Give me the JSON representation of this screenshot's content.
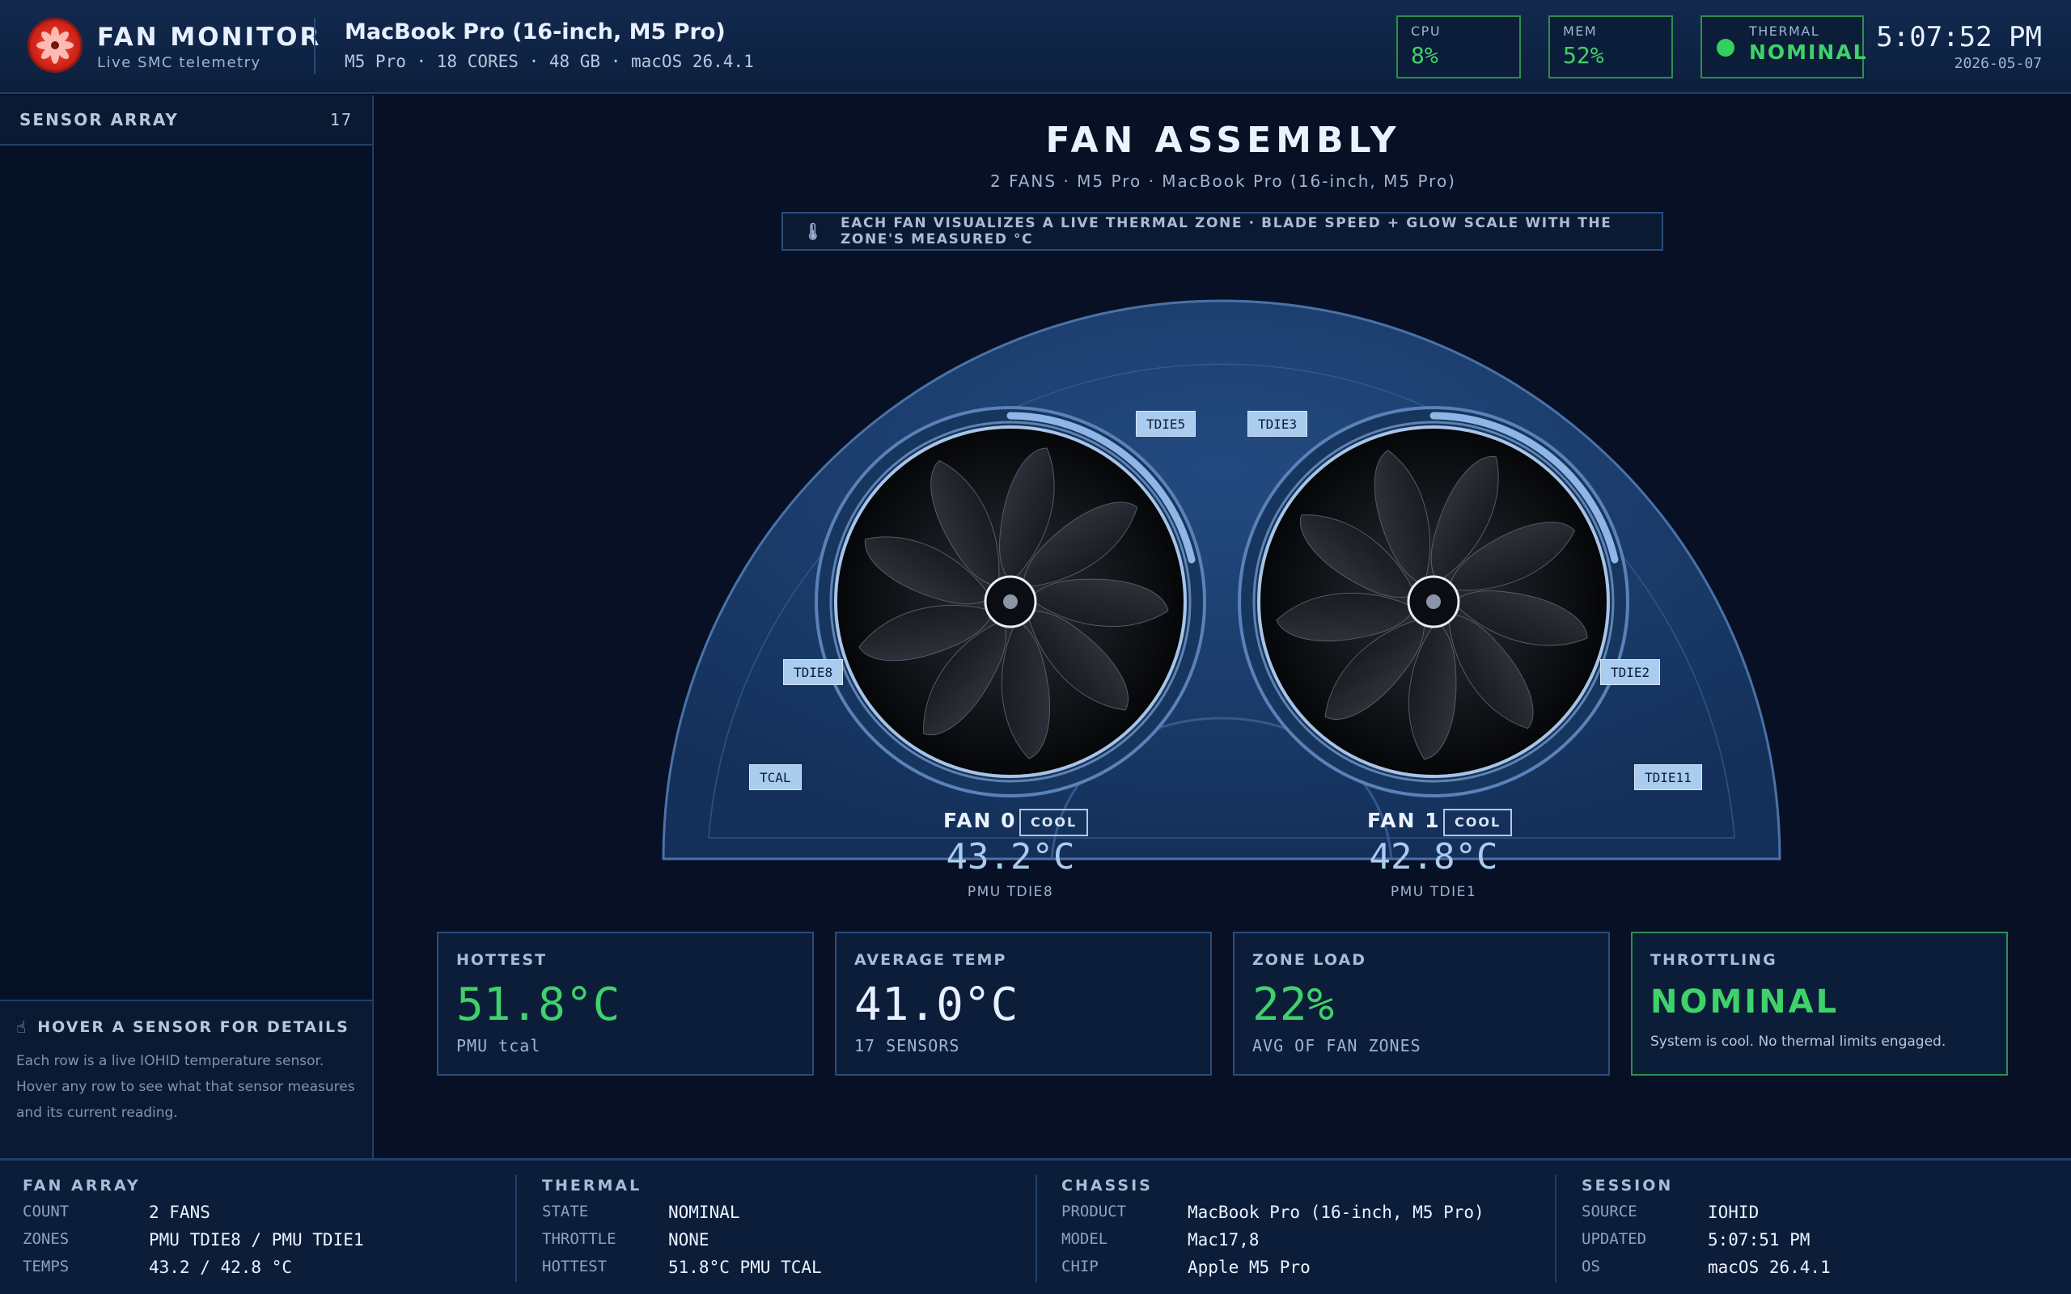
{
  "header": {
    "app_title": "FAN MONITOR",
    "app_subtitle": "Live SMC telemetry",
    "device_title": "MacBook Pro (16-inch, M5 Pro)",
    "device_specs": "M5 Pro · 18 CORES · 48 GB · macOS 26.4.1",
    "cpu_label": "CPU",
    "cpu_value": "8%",
    "mem_label": "MEM",
    "mem_value": "52%",
    "thermal_label": "THERMAL",
    "thermal_value": "NOMINAL",
    "clock": "5:07:52 PM",
    "date": "2026-05-07",
    "accent_green": "#3fd16a"
  },
  "sidebar": {
    "title": "SENSOR ARRAY",
    "count": "17",
    "help_title": "HOVER A SENSOR FOR DETAILS",
    "help_text": "Each row is a live IOHID temperature sensor. Hover any row to see what that sensor measures and its current reading.",
    "help_icon": "pointer-hand-icon"
  },
  "main": {
    "title": "FAN ASSEMBLY",
    "subtitle": "2 FANS · M5 Pro · MacBook Pro (16-inch, M5 Pro)",
    "banner_icon": "thermometer-icon",
    "banner": "EACH FAN VISUALIZES A LIVE THERMAL ZONE · BLADE SPEED + GLOW SCALE WITH THE ZONE'S MEASURED °C"
  },
  "sensors": {
    "tdie5": "TDIE5",
    "tdie3": "TDIE3",
    "tdie8": "TDIE8",
    "tdie2": "TDIE2",
    "tcal": "TCAL",
    "tdie11": "TDIE11"
  },
  "fans": [
    {
      "label": "FAN 0",
      "state": "COOL",
      "temp": "43.2°C",
      "zone": "PMU TDIE8"
    },
    {
      "label": "FAN 1",
      "state": "COOL",
      "temp": "42.8°C",
      "zone": "PMU TDIE1"
    }
  ],
  "cards": {
    "hottest": {
      "label": "HOTTEST",
      "value": "51.8°C",
      "sub": "PMU tcal"
    },
    "average": {
      "label": "AVERAGE TEMP",
      "value": "41.0°C",
      "sub": "17 SENSORS"
    },
    "zone_load": {
      "label": "ZONE LOAD",
      "value": "22%",
      "sub": "AVG OF FAN ZONES"
    },
    "throttling": {
      "label": "THROTTLING",
      "value": "NOMINAL",
      "sub": "System is cool. No thermal limits engaged."
    }
  },
  "footer": {
    "fan_array": {
      "title": "FAN ARRAY",
      "rows": [
        {
          "k": "COUNT",
          "v": "2 FANS"
        },
        {
          "k": "ZONES",
          "v": "PMU TDIE8 / PMU TDIE1"
        },
        {
          "k": "TEMPS",
          "v": "43.2 / 42.8 °C"
        }
      ]
    },
    "thermal": {
      "title": "THERMAL",
      "rows": [
        {
          "k": "STATE",
          "v": "NOMINAL"
        },
        {
          "k": "THROTTLE",
          "v": "NONE"
        },
        {
          "k": "HOTTEST",
          "v": "51.8°C PMU TCAL"
        }
      ]
    },
    "chassis": {
      "title": "CHASSIS",
      "rows": [
        {
          "k": "PRODUCT",
          "v": "MacBook Pro (16-inch, M5 Pro)"
        },
        {
          "k": "MODEL",
          "v": "Mac17,8"
        },
        {
          "k": "CHIP",
          "v": "Apple M5 Pro"
        }
      ]
    },
    "session": {
      "title": "SESSION",
      "rows": [
        {
          "k": "SOURCE",
          "v": "IOHID"
        },
        {
          "k": "UPDATED",
          "v": "5:07:51 PM"
        },
        {
          "k": "OS",
          "v": "macOS 26.4.1"
        }
      ]
    }
  }
}
